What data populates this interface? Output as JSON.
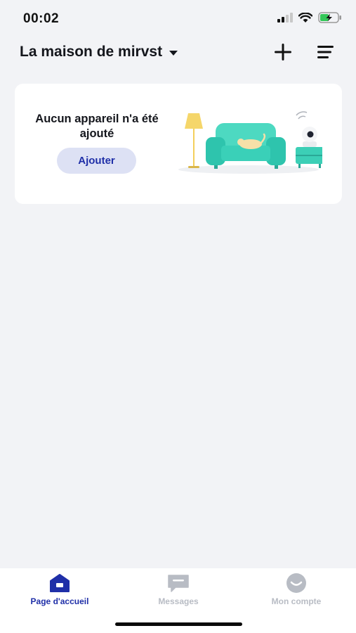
{
  "status_bar": {
    "time": "00:02",
    "icons": [
      "signal-icon",
      "wifi-icon",
      "battery-charging-icon"
    ]
  },
  "header": {
    "title": "La maison de mirvst",
    "add_icon": "plus-icon",
    "menu_icon": "menu-icon"
  },
  "empty_state": {
    "message": "Aucun appareil n'a été ajouté",
    "add_button_label": "Ajouter",
    "illustration": "living-room-illustration"
  },
  "tab_bar": {
    "tabs": [
      {
        "label": "Page d'accueil",
        "icon": "home-icon",
        "active": true
      },
      {
        "label": "Messages",
        "icon": "message-icon",
        "active": false
      },
      {
        "label": "Mon compte",
        "icon": "account-icon",
        "active": false
      }
    ]
  },
  "colors": {
    "accent": "#1f2fa8",
    "button_bg": "#dde1f4",
    "background": "#f2f3f6",
    "inactive_tab": "#b8bcc4"
  }
}
